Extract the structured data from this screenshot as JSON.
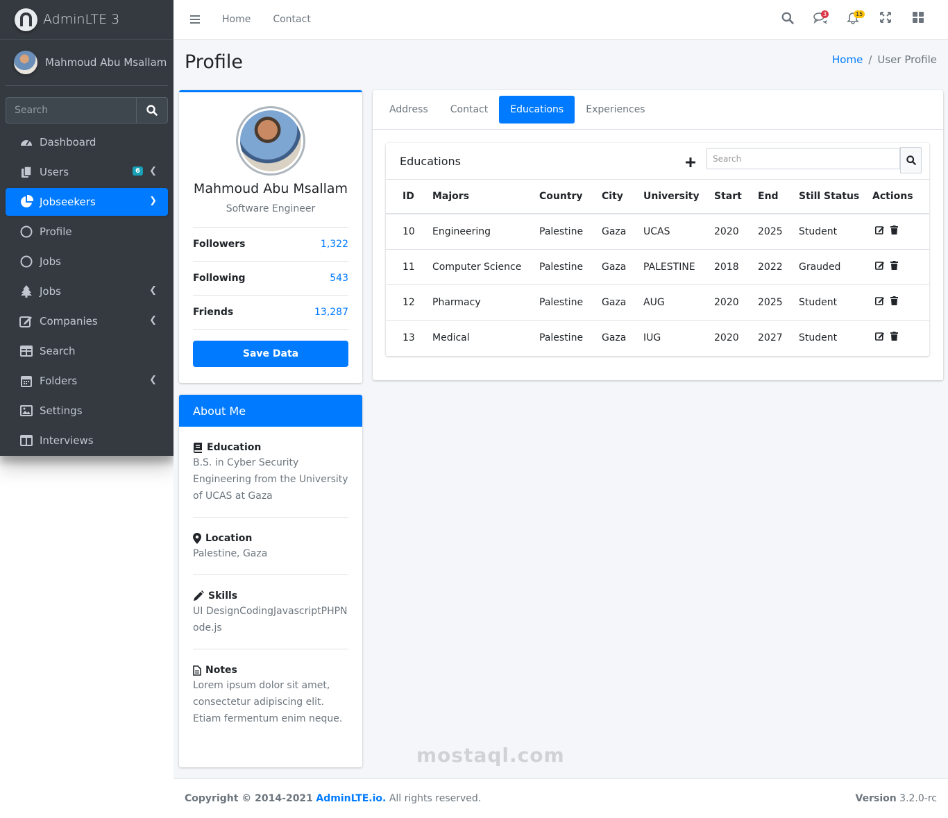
{
  "brand": {
    "name": "AdminLTE 3"
  },
  "user": {
    "name": "Mahmoud Abu Msallam"
  },
  "sidebar": {
    "search_placeholder": "Search",
    "items": [
      {
        "label": "Dashboard",
        "icon": "tachometer-icon"
      },
      {
        "label": "Users",
        "icon": "copy-icon",
        "badge": "6"
      },
      {
        "label": "Jobseekers",
        "icon": "pie-chart-icon"
      },
      {
        "label": "Profile",
        "icon": "circle-icon"
      },
      {
        "label": "Jobs",
        "icon": "circle-icon"
      },
      {
        "label": "Jobs",
        "icon": "tree-icon"
      },
      {
        "label": "Companies",
        "icon": "edit-icon"
      },
      {
        "label": "Search",
        "icon": "table-icon"
      },
      {
        "label": "Folders",
        "icon": "calendar-icon"
      },
      {
        "label": "Settings",
        "icon": "image-icon"
      },
      {
        "label": "Interviews",
        "icon": "columns-icon"
      }
    ]
  },
  "topbar": {
    "links": [
      "Home",
      "Contact"
    ],
    "messages_badge": "3",
    "notifications_badge": "15"
  },
  "page": {
    "title": "Profile",
    "breadcrumb": {
      "home": "Home",
      "separator": "/",
      "current": "User Profile"
    }
  },
  "profile": {
    "name": "Mahmoud Abu Msallam",
    "role": "Software Engineer",
    "stats": [
      {
        "label": "Followers",
        "value": "1,322"
      },
      {
        "label": "Following",
        "value": "543"
      },
      {
        "label": "Friends",
        "value": "13,287"
      }
    ],
    "save_label": "Save Data"
  },
  "about": {
    "title": "About Me",
    "sections": [
      {
        "title": "Education",
        "text": "B.S. in Cyber Security Engineering from the University of UCAS at Gaza",
        "icon": "book-icon"
      },
      {
        "title": "Location",
        "text": "Palestine, Gaza",
        "icon": "map-marker-icon"
      },
      {
        "title": "Skills",
        "text": "UI DesignCodingJavascriptPHPNode.js",
        "icon": "pencil-icon"
      },
      {
        "title": "Notes",
        "text": "Lorem ipsum dolor sit amet, consectetur adipiscing elit. Etiam fermentum enim neque.",
        "icon": "file-icon"
      }
    ]
  },
  "tabs": [
    "Address",
    "Contact",
    "Educations",
    "Experiences"
  ],
  "educations": {
    "title": "Educations",
    "search_placeholder": "Search",
    "columns": [
      "ID",
      "Majors",
      "Country",
      "City",
      "University",
      "Start",
      "End",
      "Still Status",
      "Actions"
    ],
    "rows": [
      [
        "10",
        "Engineering",
        "Palestine",
        "Gaza",
        "UCAS",
        "2020",
        "2025",
        "Student"
      ],
      [
        "11",
        "Computer Science",
        "Palestine",
        "Gaza",
        "PALESTINE",
        "2018",
        "2022",
        "Grauded"
      ],
      [
        "12",
        "Pharmacy",
        "Palestine",
        "Gaza",
        "AUG",
        "2020",
        "2025",
        "Student"
      ],
      [
        "13",
        "Medical",
        "Palestine",
        "Gaza",
        "IUG",
        "2020",
        "2027",
        "Student"
      ]
    ]
  },
  "footer": {
    "copyright": "Copyright © 2014-2021",
    "link": "AdminLTE.io.",
    "rights": "All rights reserved.",
    "version_label": "Version",
    "version": "3.2.0-rc",
    "watermark": "mostaql.com"
  }
}
